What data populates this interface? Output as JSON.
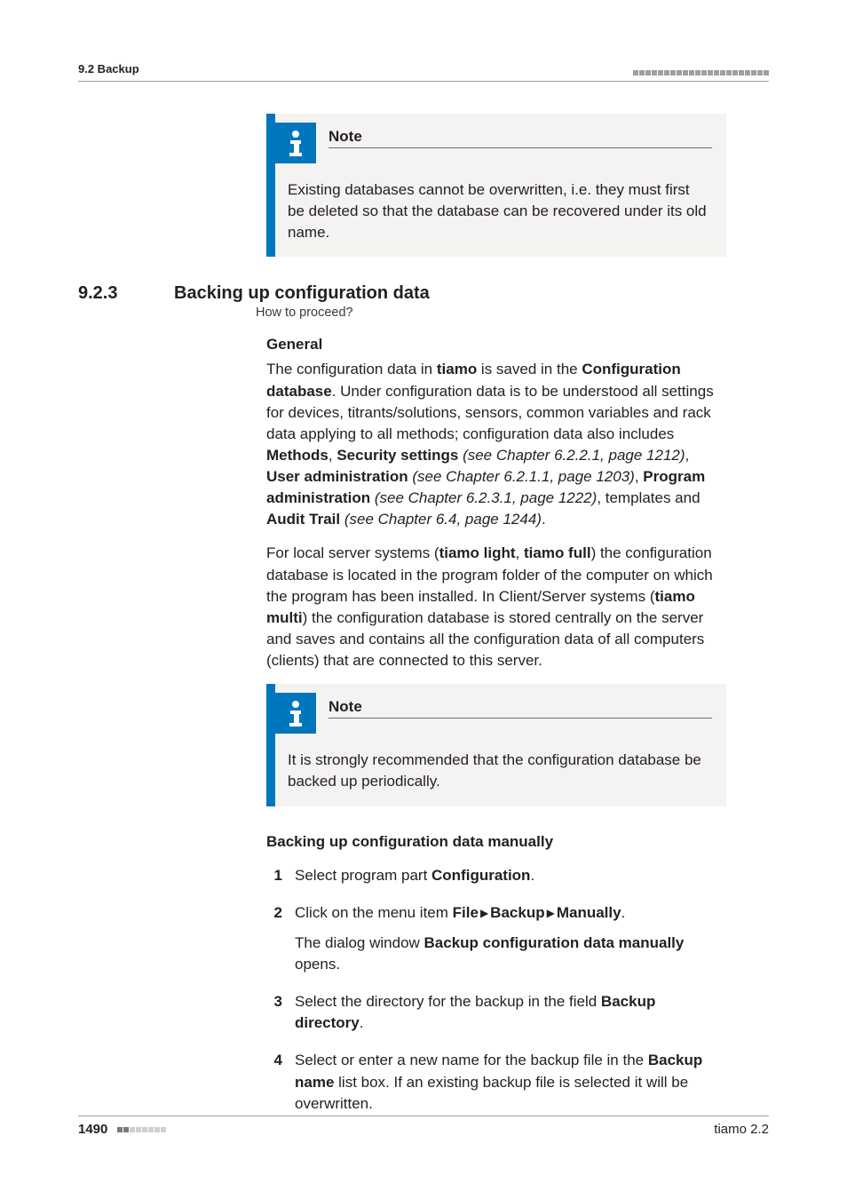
{
  "header": {
    "section_label": "9.2 Backup"
  },
  "note1": {
    "title": "Note",
    "body": "Existing databases cannot be overwritten, i.e. they must first be deleted so that the database can be recovered under its old name."
  },
  "section": {
    "number": "9.2.3",
    "title": "Backing up configuration data",
    "proceed": "How to proceed?"
  },
  "general": {
    "heading": "General",
    "p1_a": "The configuration data in ",
    "p1_b": "tiamo",
    "p1_c": " is saved in the ",
    "p1_d": "Configuration database",
    "p1_e": ". Under configuration data is to be understood all settings for devices, titrants/solutions, sensors, common variables and rack data applying to all methods; configuration data also includes ",
    "p1_f": "Methods",
    "p1_g": ", ",
    "p1_h": "Security settings",
    "p1_i": " (see Chapter 6.2.2.1, page 1212)",
    "p1_j": ", ",
    "p1_k": "User administration",
    "p1_l": " (see Chapter 6.2.1.1, page 1203)",
    "p1_m": ", ",
    "p1_n": "Program administration",
    "p1_o": " (see Chapter 6.2.3.1, page 1222)",
    "p1_p": ", templates and ",
    "p1_q": "Audit Trail",
    "p1_r": " (see Chapter 6.4, page 1244)",
    "p1_s": ".",
    "p2_a": "For local server systems (",
    "p2_b": "tiamo light",
    "p2_c": ", ",
    "p2_d": "tiamo full",
    "p2_e": ") the configuration database is located in the program folder of the computer on which the program has been installed. In Client/Server systems (",
    "p2_f": "tiamo multi",
    "p2_g": ") the configuration database is stored centrally on the server and saves and contains all the configuration data of all computers (clients) that are connected to this server."
  },
  "note2": {
    "title": "Note",
    "body": "It is strongly recommended that the configuration database be backed up periodically."
  },
  "manual": {
    "heading": "Backing up configuration data manually",
    "steps": {
      "s1_a": "Select program part ",
      "s1_b": "Configuration",
      "s1_c": ".",
      "s2_a": "Click on the menu item ",
      "s2_b": "File",
      "s2_c": "Backup",
      "s2_d": "Manually",
      "s2_e": ".",
      "s2_f": "The dialog window ",
      "s2_g": "Backup configuration data manually",
      "s2_h": " opens.",
      "s3_a": "Select the directory for the backup in the field ",
      "s3_b": "Backup directory",
      "s3_c": ".",
      "s4_a": "Select or enter a new name for the backup file in the ",
      "s4_b": "Backup name",
      "s4_c": " list box. If an existing backup file is selected it will be overwritten."
    },
    "numbers": {
      "n1": "1",
      "n2": "2",
      "n3": "3",
      "n4": "4"
    }
  },
  "footer": {
    "page": "1490",
    "product": "tiamo 2.2"
  }
}
